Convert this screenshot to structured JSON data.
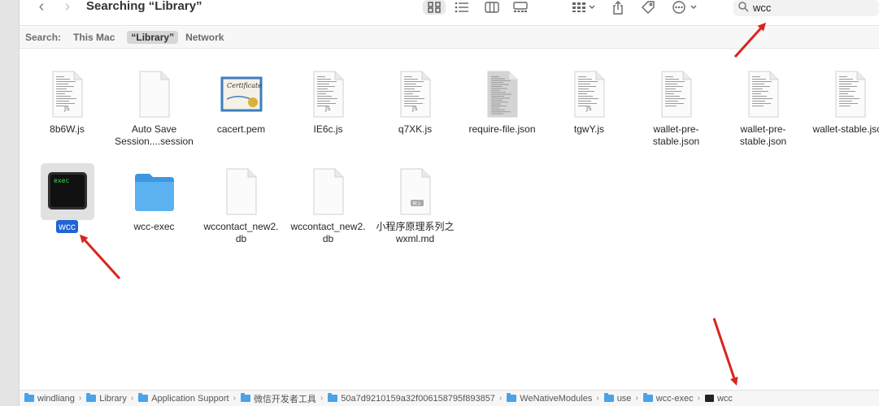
{
  "window": {
    "title": "Searching “Library”"
  },
  "toolbar": {
    "back": "‹",
    "forward": "›"
  },
  "search": {
    "value": "wcc"
  },
  "scope": {
    "label": "Search:",
    "items": [
      "This Mac",
      "“Library”",
      "Network"
    ],
    "selected_index": 1
  },
  "files": {
    "row1": [
      {
        "line1": "8b6W.js",
        "line2": "",
        "badge": "JS",
        "type": "text-doc"
      },
      {
        "line1": "Auto Save",
        "line2": "Session....session",
        "badge": "",
        "type": "blank-doc"
      },
      {
        "line1": "cacert.pem",
        "line2": "",
        "badge": "Certificate",
        "type": "certificate"
      },
      {
        "line1": "IE6c.js",
        "line2": "",
        "badge": "JS",
        "type": "text-doc"
      },
      {
        "line1": "q7XK.js",
        "line2": "",
        "badge": "JS",
        "type": "text-doc"
      },
      {
        "line1": "require-file.json",
        "line2": "",
        "badge": "",
        "type": "dense-doc"
      },
      {
        "line1": "tgwY.js",
        "line2": "",
        "badge": "JS",
        "type": "text-doc"
      },
      {
        "line1": "wallet-pre-",
        "line2": "stable.json",
        "badge": "",
        "type": "text-doc"
      },
      {
        "line1": "wallet-pre-",
        "line2": "stable.json",
        "badge": "",
        "type": "text-doc"
      },
      {
        "line1": "wallet-stable.json",
        "line2": "",
        "badge": "",
        "type": "text-doc"
      }
    ],
    "row2": [
      {
        "line1": "wcc",
        "line2": "",
        "badge": "exec",
        "type": "exec"
      },
      {
        "line1": "wcc-exec",
        "line2": "",
        "badge": "",
        "type": "folder"
      },
      {
        "line1": "wccontact_new2.",
        "line2": "db",
        "badge": "",
        "type": "blank-doc"
      },
      {
        "line1": "wccontact_new2.",
        "line2": "db",
        "badge": "",
        "type": "blank-doc"
      },
      {
        "line1": "小程序原理系列之",
        "line2": "wxml.md",
        "badge": "M↓",
        "type": "markdown"
      }
    ]
  },
  "pathbar": [
    {
      "label": "windliang",
      "kind": "folder"
    },
    {
      "label": "Library",
      "kind": "folder"
    },
    {
      "label": "Application Support",
      "kind": "folder"
    },
    {
      "label": "微信开发者工具",
      "kind": "folder"
    },
    {
      "label": "50a7d9210159a32f006158795f893857",
      "kind": "folder"
    },
    {
      "label": "WeNativeModules",
      "kind": "folder"
    },
    {
      "label": "use",
      "kind": "folder"
    },
    {
      "label": "wcc-exec",
      "kind": "folder"
    },
    {
      "label": "wcc",
      "kind": "exec"
    }
  ],
  "colors": {
    "selection": "#1f63d6",
    "folder": "#4aa3e8",
    "arrow": "#d9241c"
  }
}
